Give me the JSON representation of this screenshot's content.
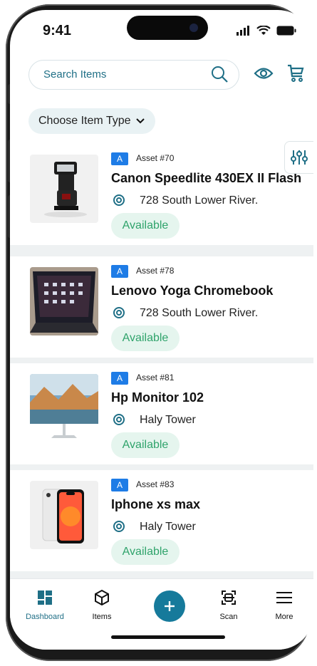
{
  "status_bar": {
    "time": "9:41"
  },
  "search": {
    "placeholder": "Search Items",
    "icon": "search-icon"
  },
  "header_icons": {
    "eye": "eye-icon",
    "cart": "cart-icon"
  },
  "filter_chip": {
    "label": "Choose Item Type",
    "icon": "chevron-down-icon"
  },
  "colors": {
    "accent": "#1f6f86",
    "badge": "#1e7ce6",
    "available": "#2fa36b",
    "available_bg": "#e5f5ee",
    "fab": "#167a9b"
  },
  "items": [
    {
      "badge": "A",
      "asset": "Asset #70",
      "title": "Canon Speedlite 430EX II Flash",
      "location": "728 South Lower River.",
      "status": "Available"
    },
    {
      "badge": "A",
      "asset": "Asset #78",
      "title": "Lenovo Yoga Chromebook",
      "location": "728 South Lower River.",
      "status": "Available"
    },
    {
      "badge": "A",
      "asset": "Asset #81",
      "title": "Hp Monitor 102",
      "location": "Haly Tower",
      "status": "Available"
    },
    {
      "badge": "A",
      "asset": "Asset #83",
      "title": "Iphone xs max",
      "location": "Haly Tower",
      "status": "Available"
    }
  ],
  "bottom_nav": {
    "dashboard": "Dashboard",
    "items": "Items",
    "scan": "Scan",
    "more": "More"
  }
}
